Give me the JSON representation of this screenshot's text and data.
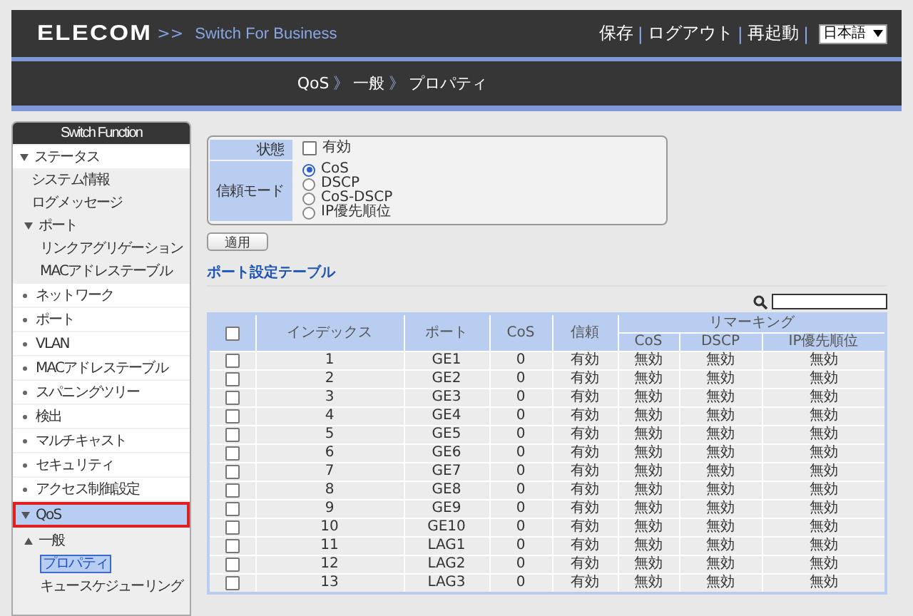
{
  "header": {
    "logo": "ELECOM",
    "prompt": ">>",
    "product": "Switch For Business",
    "nav": [
      {
        "kind": "link",
        "text": "保存"
      },
      {
        "kind": "separator",
        "text": "|"
      },
      {
        "kind": "link",
        "text": "ログアウト"
      },
      {
        "kind": "separator",
        "text": "|"
      },
      {
        "kind": "link",
        "text": "再起動"
      },
      {
        "kind": "separator",
        "text": "|"
      },
      {
        "kind": "select",
        "text": "日本語"
      }
    ]
  },
  "breadcrumb": [
    {
      "kind": "item",
      "text": "QoS"
    },
    {
      "kind": "separator",
      "text": "》"
    },
    {
      "kind": "item",
      "text": "一般"
    },
    {
      "kind": "separator",
      "text": "》"
    },
    {
      "kind": "item",
      "text": "プロパティ"
    }
  ],
  "sidebar": {
    "title": "Switch Function",
    "items": [
      {
        "label": "ステータス",
        "expanded": true,
        "selected": false,
        "children": [
          {
            "label": "システム情報",
            "selected": false
          },
          {
            "label": "ログメッセージ",
            "selected": false
          },
          {
            "label": "ポート",
            "expanded": true,
            "selected": false,
            "children": [
              {
                "label": "リンクアグリゲーション",
                "selected": false
              },
              {
                "label": "MACアドレステーブル",
                "selected": false
              }
            ]
          }
        ]
      },
      {
        "label": "ネットワーク",
        "expanded": false,
        "selected": false
      },
      {
        "label": "ポート",
        "expanded": false,
        "selected": false
      },
      {
        "label": "VLAN",
        "expanded": false,
        "selected": false
      },
      {
        "label": "MACアドレステーブル",
        "expanded": false,
        "selected": false
      },
      {
        "label": "スパニングツリー",
        "expanded": false,
        "selected": false
      },
      {
        "label": "検出",
        "expanded": false,
        "selected": false
      },
      {
        "label": "マルチキャスト",
        "expanded": false,
        "selected": false
      },
      {
        "label": "セキュリティ",
        "expanded": false,
        "selected": false
      },
      {
        "label": "アクセス制御設定",
        "expanded": false,
        "selected": false
      },
      {
        "label": "QoS",
        "expanded": true,
        "selected": true,
        "children": [
          {
            "label": "一般",
            "expanded": true,
            "selected": false,
            "children": [
              {
                "label": "プロパティ",
                "selected": true
              },
              {
                "label": "キュースケジューリング",
                "selected": false
              }
            ]
          }
        ]
      }
    ]
  },
  "form": {
    "state": {
      "label": "状態",
      "option": "有効",
      "checked": false
    },
    "trust_mode": {
      "label": "信頼モード",
      "options": [
        {
          "label": "CoS",
          "selected": true
        },
        {
          "label": "DSCP",
          "selected": false
        },
        {
          "label": "CoS-DSCP",
          "selected": false
        },
        {
          "label": "IP優先順位",
          "selected": false
        }
      ]
    },
    "apply_button": "適用"
  },
  "table": {
    "title": "ポート設定テーブル",
    "select_all": false,
    "columns": [
      "インデックス",
      "ポート",
      "CoS",
      "信頼"
    ],
    "group": "リマーキング",
    "subcolumns": [
      "CoS",
      "DSCP",
      "IP優先順位"
    ],
    "rows": [
      {
        "checked": false,
        "cells": [
          "1",
          "GE1",
          "0",
          "有効",
          "無効",
          "無効",
          "無効"
        ]
      },
      {
        "checked": false,
        "cells": [
          "2",
          "GE2",
          "0",
          "有効",
          "無効",
          "無効",
          "無効"
        ]
      },
      {
        "checked": false,
        "cells": [
          "3",
          "GE3",
          "0",
          "有効",
          "無効",
          "無効",
          "無効"
        ]
      },
      {
        "checked": false,
        "cells": [
          "4",
          "GE4",
          "0",
          "有効",
          "無効",
          "無効",
          "無効"
        ]
      },
      {
        "checked": false,
        "cells": [
          "5",
          "GE5",
          "0",
          "有効",
          "無効",
          "無効",
          "無効"
        ]
      },
      {
        "checked": false,
        "cells": [
          "6",
          "GE6",
          "0",
          "有効",
          "無効",
          "無効",
          "無効"
        ]
      },
      {
        "checked": false,
        "cells": [
          "7",
          "GE7",
          "0",
          "有効",
          "無効",
          "無効",
          "無効"
        ]
      },
      {
        "checked": false,
        "cells": [
          "8",
          "GE8",
          "0",
          "有効",
          "無効",
          "無効",
          "無効"
        ]
      },
      {
        "checked": false,
        "cells": [
          "9",
          "GE9",
          "0",
          "有効",
          "無効",
          "無効",
          "無効"
        ]
      },
      {
        "checked": false,
        "cells": [
          "10",
          "GE10",
          "0",
          "有効",
          "無効",
          "無効",
          "無効"
        ]
      },
      {
        "checked": false,
        "cells": [
          "11",
          "LAG1",
          "0",
          "有効",
          "無効",
          "無効",
          "無効"
        ]
      },
      {
        "checked": false,
        "cells": [
          "12",
          "LAG2",
          "0",
          "有効",
          "無効",
          "無効",
          "無効"
        ]
      },
      {
        "checked": false,
        "cells": [
          "13",
          "LAG3",
          "0",
          "有効",
          "無効",
          "無効",
          "無効"
        ]
      }
    ]
  }
}
